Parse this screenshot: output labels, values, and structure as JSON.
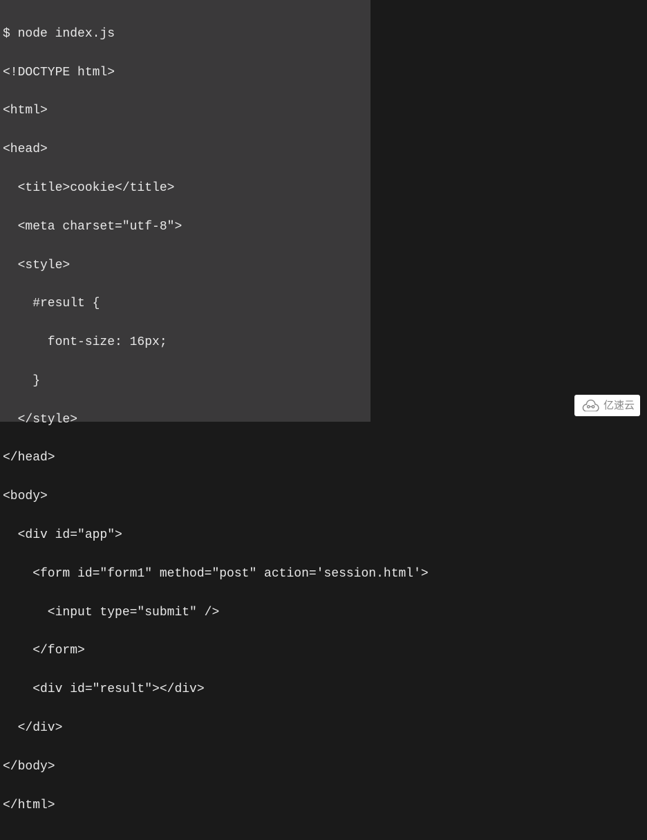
{
  "lines": [
    "$ node index.js",
    "<!DOCTYPE html>",
    "<html>",
    "<head>",
    "  <title>cookie</title>",
    "  <meta charset=\"utf-8\">",
    "  <style>",
    "    #result {",
    "      font-size: 16px;",
    "    }",
    "  </style>",
    "</head>",
    "<body>",
    "  <div id=\"app\">",
    "    <form id=\"form1\" method=\"post\" action='session.html'>",
    "      <input type=\"submit\" />",
    "    </form>",
    "    <div id=\"result\"></div>",
    "  </div>",
    "</body>",
    "</html>"
  ],
  "watermark": {
    "text": "亿速云"
  }
}
